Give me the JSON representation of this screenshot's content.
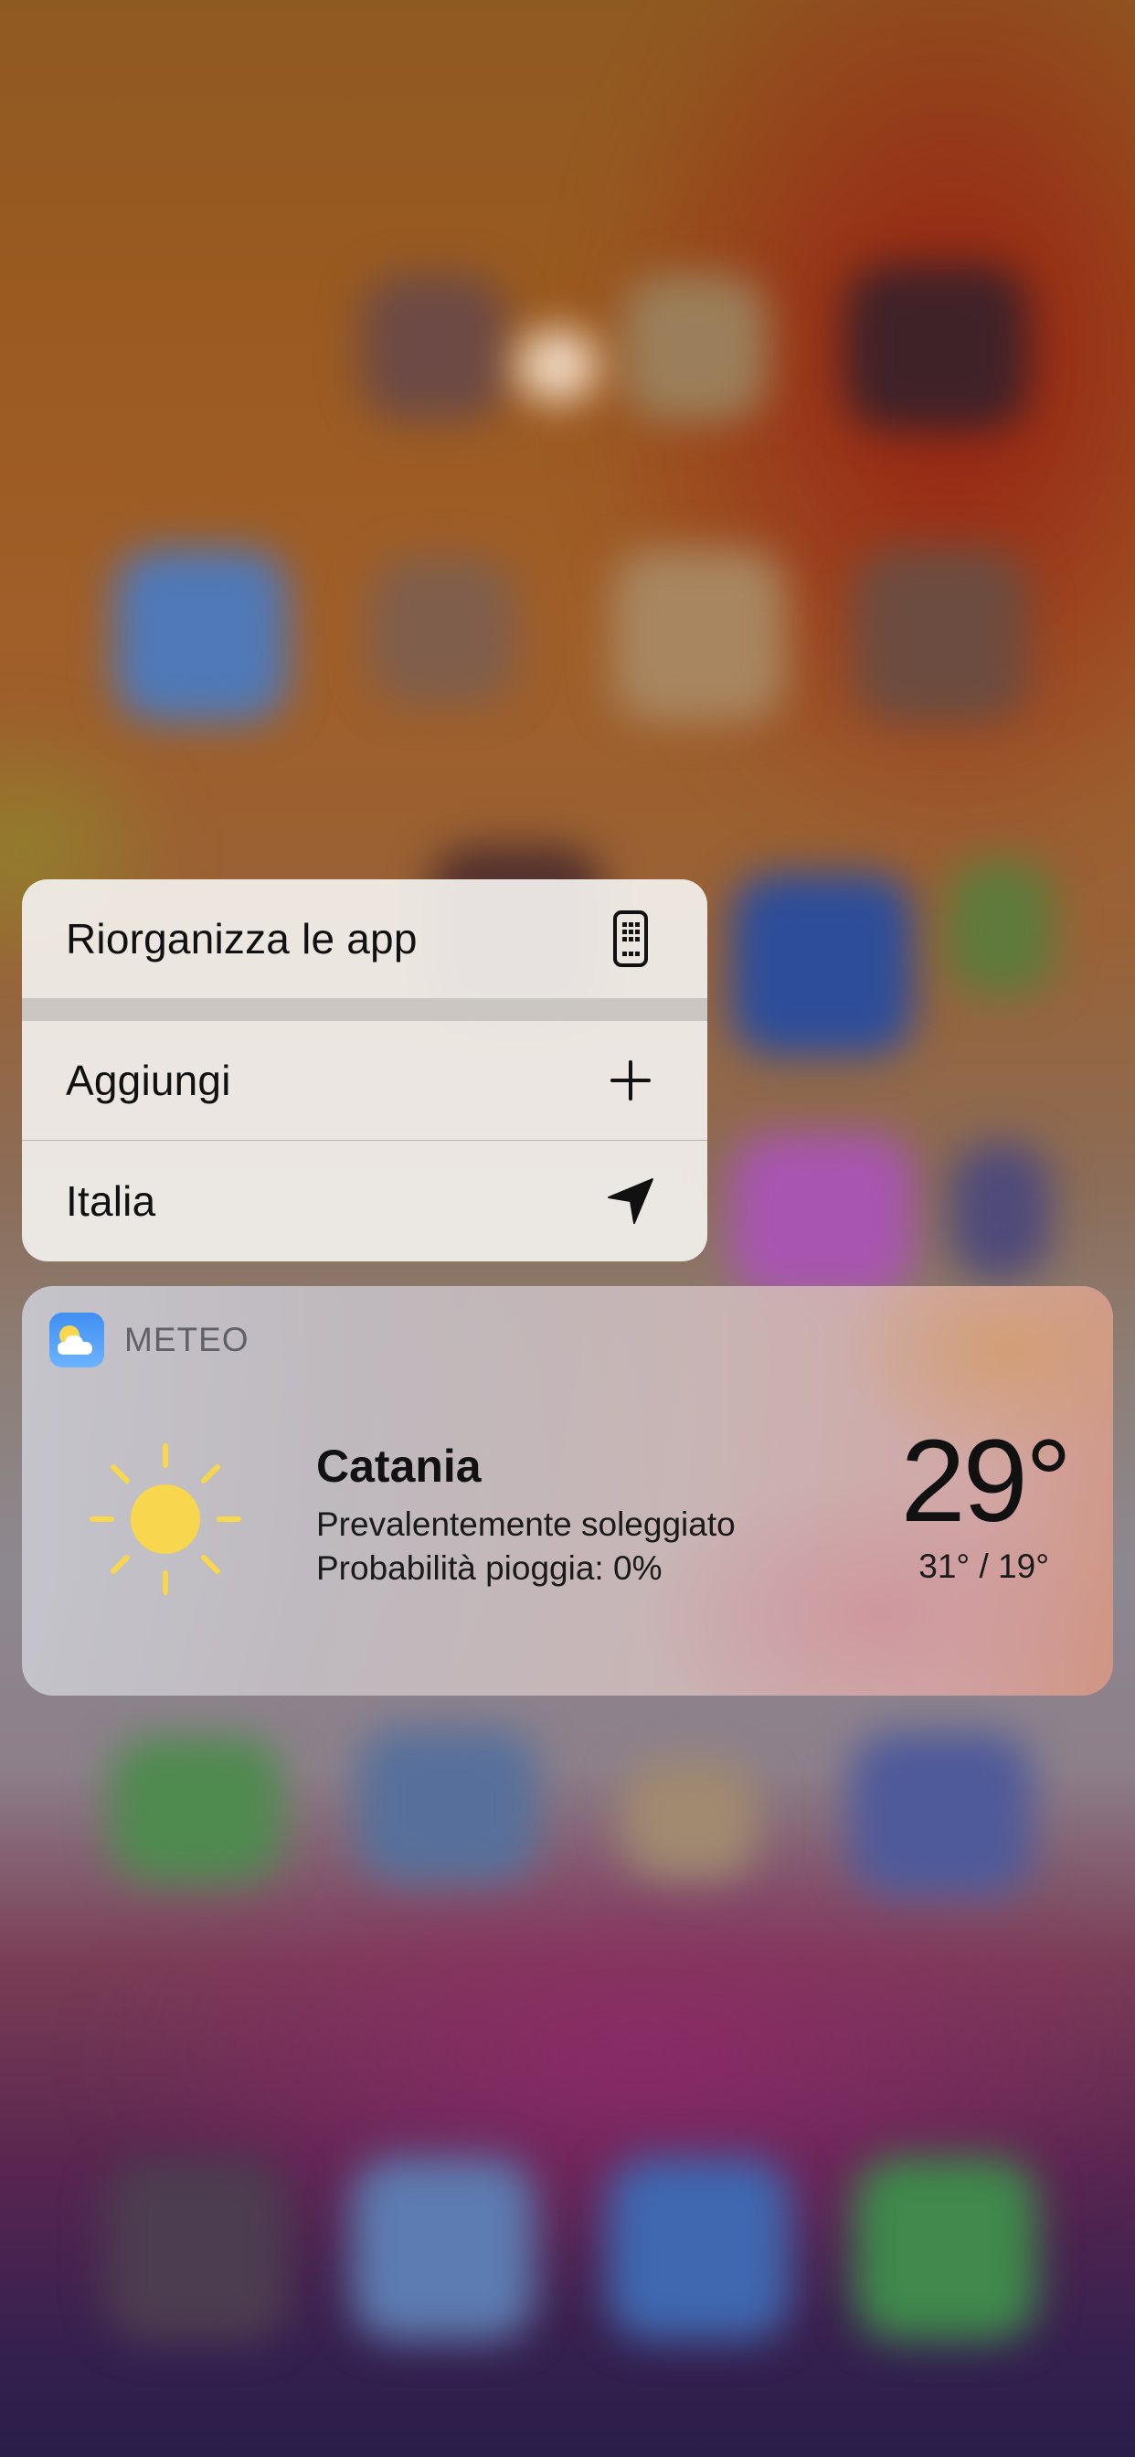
{
  "quick_actions": {
    "items": [
      {
        "label": "Riorganizza le app",
        "icon": "edit-home-screen-icon"
      },
      {
        "label": "Aggiungi",
        "icon": "plus-icon"
      },
      {
        "label": "Italia",
        "icon": "location-arrow-icon"
      }
    ]
  },
  "widget": {
    "app_name": "METEO",
    "app_icon": "weather-app-icon",
    "condition_icon": "sun-icon",
    "city": "Catania",
    "condition": "Prevalentemente soleggiato",
    "rain": "Probabilità pioggia: 0%",
    "temperature": "29°",
    "range": "31° / 19°"
  },
  "colors": {
    "sun": "#f8d64e",
    "app_icon_top": "#3f8ff2",
    "app_icon_bottom": "#6cb3ff"
  }
}
